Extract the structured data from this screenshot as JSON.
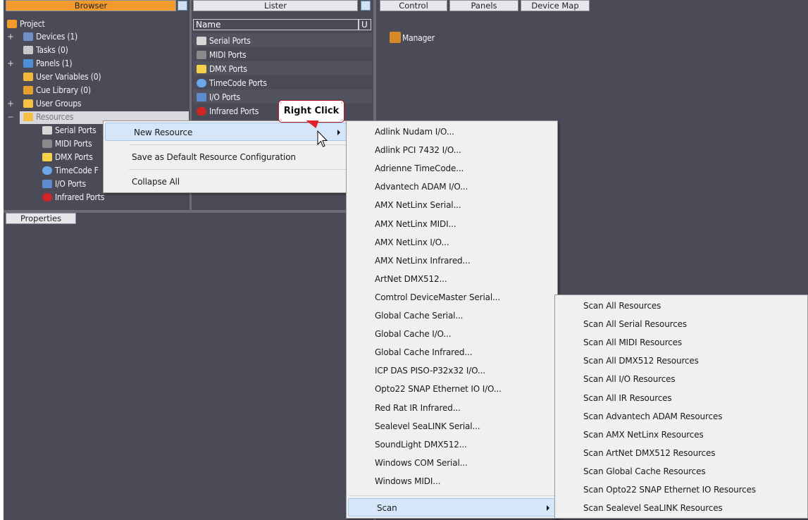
{
  "tabs_left": {
    "browser": "Browser",
    "lister": "Lister"
  },
  "tabs_right": [
    "Control",
    "Panels",
    "Device Map"
  ],
  "properties_tab": "Properties",
  "tree": {
    "project": "Project",
    "devices": "Devices (1)",
    "tasks": "Tasks (0)",
    "panels": "Panels (1)",
    "user_variables": "User Variables (0)",
    "cue_library": "Cue Library (0)",
    "user_groups": "User Groups",
    "resources": "Resources",
    "resource_children": [
      "Serial Ports",
      "MIDI Ports",
      "DMX Ports",
      "TimeCode F",
      "I/O Ports",
      "Infrared Ports"
    ]
  },
  "lister": {
    "col_name": "Name",
    "col_u": "U",
    "items": [
      "Serial Ports",
      "MIDI Ports",
      "DMX Ports",
      "TimeCode Ports",
      "I/O Ports",
      "Infrared Ports"
    ]
  },
  "control": {
    "manager": "Manager"
  },
  "callout": "Right Click",
  "context_menu": {
    "new_resource": "New Resource",
    "save_default": "Save as Default Resource Configuration",
    "collapse_all": "Collapse All"
  },
  "submenu_new": [
    "Adlink Nudam I/O...",
    "Adlink PCI 7432 I/O...",
    "Adrienne TimeCode...",
    "Advantech ADAM I/O...",
    "AMX NetLinx Serial...",
    "AMX NetLinx MIDI...",
    "AMX NetLinx I/O...",
    "AMX NetLinx Infrared...",
    "ArtNet DMX512...",
    "Comtrol DeviceMaster Serial...",
    "Global Cache Serial...",
    "Global Cache I/O...",
    "Global Cache Infrared...",
    "ICP DAS PISO-P32x32 I/O...",
    "Opto22 SNAP Ethernet IO I/O...",
    "Red Rat IR Infrared...",
    "Sealevel SeaLINK Serial...",
    "SoundLight DMX512...",
    "Windows COM Serial...",
    "Windows MIDI..."
  ],
  "submenu_scan_label": "Scan",
  "submenu_scan": [
    "Scan All Resources",
    "Scan All Serial Resources",
    "Scan All MIDI Resources",
    "Scan All DMX512 Resources",
    "Scan All I/O Resources",
    "Scan All IR Resources",
    "Scan Advantech ADAM Resources",
    "Scan AMX NetLinx Resources",
    "Scan ArtNet DMX512 Resources",
    "Scan Global Cache Resources",
    "Scan Opto22 SNAP Ethernet IO Resources",
    "Scan Sealevel SeaLINK Resources"
  ],
  "colors": {
    "panel_bg": "#4a4b56",
    "accent_tab": "#f39a2d",
    "menu_bg": "#f0f0f0",
    "callout_red": "#e0202a"
  }
}
